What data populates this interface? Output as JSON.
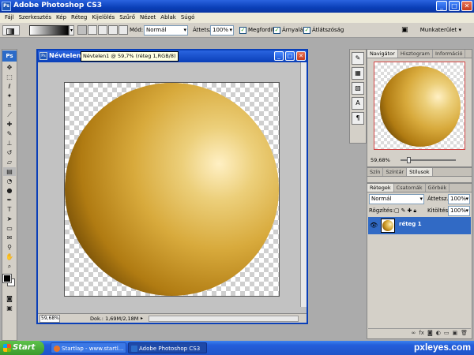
{
  "app": {
    "title": "Adobe Photoshop CS3",
    "icon_label": "Ps"
  },
  "menu": [
    "Fájl",
    "Szerkesztés",
    "Kép",
    "Réteg",
    "Kijelölés",
    "Szűrő",
    "Nézet",
    "Ablak",
    "Súgó"
  ],
  "options": {
    "mode_label": "Mód:",
    "mode_value": "Normál",
    "opacity_label": "Áttetsz.:",
    "opacity_value": "100%",
    "reverse_label": "Megfordít",
    "dither_label": "Árnyalás",
    "transparency_label": "Átlátszóság",
    "workspace_label": "Munkaterület ▾"
  },
  "document": {
    "name": "Névtelen1",
    "title_full": "Névtelen1 @ 59,7% (réteg 1,RGB/8)",
    "zoom": "59,68%",
    "doc_info": "Dok.: 1,69M/2,18M"
  },
  "navigator": {
    "tabs": [
      "Navigátor",
      "Hisztogram",
      "Információ"
    ],
    "zoom": "59,68%"
  },
  "color_panel": {
    "tabs": [
      "Szín",
      "Színtár",
      "Stílusok"
    ]
  },
  "layers": {
    "tabs": [
      "Rétegek",
      "Csatornák",
      "Görbék"
    ],
    "blend_mode": "Normál",
    "opacity_label": "Áttetsz.:",
    "opacity_value": "100%",
    "lock_label": "Rögzítés:",
    "fill_label": "Kitöltés:",
    "fill_value": "100%",
    "items": [
      {
        "name": "réteg 1"
      }
    ]
  },
  "taskbar": {
    "start_label": "Start",
    "tasks": [
      "Startlap - www.startl...",
      "Adobe Photoshop CS3"
    ],
    "watermark": "pxleyes.com"
  },
  "colors": {
    "titlebar": "#0a3fb8",
    "accent_layer": "#316ac5",
    "sphere_mid": "#d8aa3c"
  }
}
